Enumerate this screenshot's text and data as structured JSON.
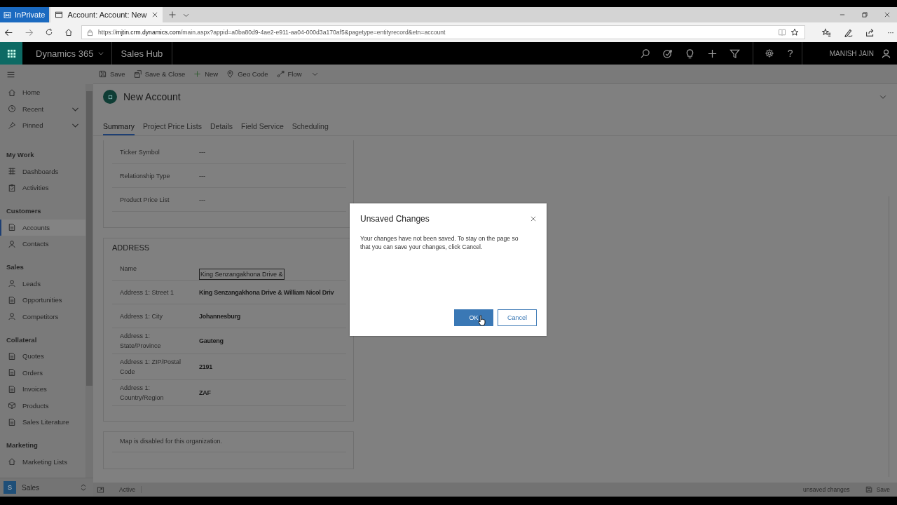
{
  "browser": {
    "private_label": "InPrivate",
    "tab_title": "Account: Account: New",
    "url": "https://**mjtin.crm.dynamics.com**/main.aspx?appid=a0ba80d9-4ae2-e911-aa04-000d3a170af5&pagetype=entityrecord&etn=account",
    "more": "···"
  },
  "app_header": {
    "app_name": "Dynamics 365",
    "area": "Sales Hub",
    "help": "?",
    "user": "MANISH JAIN"
  },
  "sidebar": {
    "groups": [
      {
        "items": [
          {
            "label": "Home",
            "selected": false
          },
          {
            "label": "Recent",
            "selected": false,
            "expanded": false
          },
          {
            "label": "Pinned",
            "selected": false,
            "expanded": false
          }
        ]
      },
      {
        "title": "My Work",
        "items": [
          {
            "label": "Dashboards",
            "selected": false
          },
          {
            "label": "Activities",
            "selected": false
          }
        ]
      },
      {
        "title": "Customers",
        "items": [
          {
            "label": "Accounts",
            "selected": true
          },
          {
            "label": "Contacts",
            "selected": false
          }
        ]
      },
      {
        "title": "Sales",
        "items": [
          {
            "label": "Leads",
            "selected": false
          },
          {
            "label": "Opportunities",
            "selected": false
          },
          {
            "label": "Competitors",
            "selected": false
          }
        ]
      },
      {
        "title": "Collateral",
        "items": [
          {
            "label": "Quotes",
            "selected": false
          },
          {
            "label": "Orders",
            "selected": false
          },
          {
            "label": "Invoices",
            "selected": false
          },
          {
            "label": "Products",
            "selected": false
          },
          {
            "label": "Sales Literature",
            "selected": false
          }
        ]
      },
      {
        "title": "Marketing",
        "items": [
          {
            "label": "Marketing Lists",
            "selected": false
          }
        ]
      }
    ],
    "area_switcher": {
      "badge": "S",
      "label": "Sales"
    }
  },
  "command_bar": [
    {
      "label": "Save",
      "dropdown": false
    },
    {
      "label": "Save & Close",
      "dropdown": false
    },
    {
      "label": "New",
      "dropdown": false
    },
    {
      "label": "Geo Code",
      "dropdown": false
    },
    {
      "label": "Flow",
      "dropdown": true
    }
  ],
  "record": {
    "title": "New Account",
    "tabs": [
      {
        "label": "Summary",
        "selected": true
      },
      {
        "label": "Project Price Lists",
        "selected": false
      },
      {
        "label": "Details",
        "selected": false
      },
      {
        "label": "Field Service",
        "selected": false
      },
      {
        "label": "Scheduling",
        "selected": false
      }
    ],
    "sections": [
      {
        "fields": [
          {
            "label": "Ticker Symbol",
            "value": "---",
            "kind": "empty"
          },
          {
            "label": "Relationship Type",
            "value": "---",
            "kind": "empty"
          },
          {
            "label": "Product Price List",
            "value": "---",
            "kind": "empty"
          }
        ]
      },
      {
        "title": "ADDRESS",
        "fields": [
          {
            "label": "Name",
            "value": "King Senzangakhona Drive &",
            "kind": "input"
          },
          {
            "label": "Address 1: Street 1",
            "value": "King Senzangakhona Drive & William Nicol Driv",
            "kind": "text"
          },
          {
            "label": "Address 1: City",
            "value": "Johannesburg",
            "kind": "text"
          },
          {
            "label": "Address 1: State/Province",
            "value": "Gauteng",
            "kind": "text"
          },
          {
            "label": "Address 1: ZIP/Postal Code",
            "value": "2191",
            "kind": "text"
          },
          {
            "label": "Address 1: Country/Region",
            "value": "ZAF",
            "kind": "text"
          }
        ]
      },
      {
        "message": "Map is disabled for this organization."
      }
    ]
  },
  "status_bar": {
    "status": "Active",
    "changes": "unsaved changes",
    "save": "Save"
  },
  "dialog": {
    "title": "Unsaved Changes",
    "message": "Your changes have not been saved. To stay on the page so that you can save your changes, click Cancel.",
    "buttons": [
      {
        "label": "OK",
        "kind": "primary"
      },
      {
        "label": "Cancel",
        "kind": "secondary"
      }
    ]
  }
}
